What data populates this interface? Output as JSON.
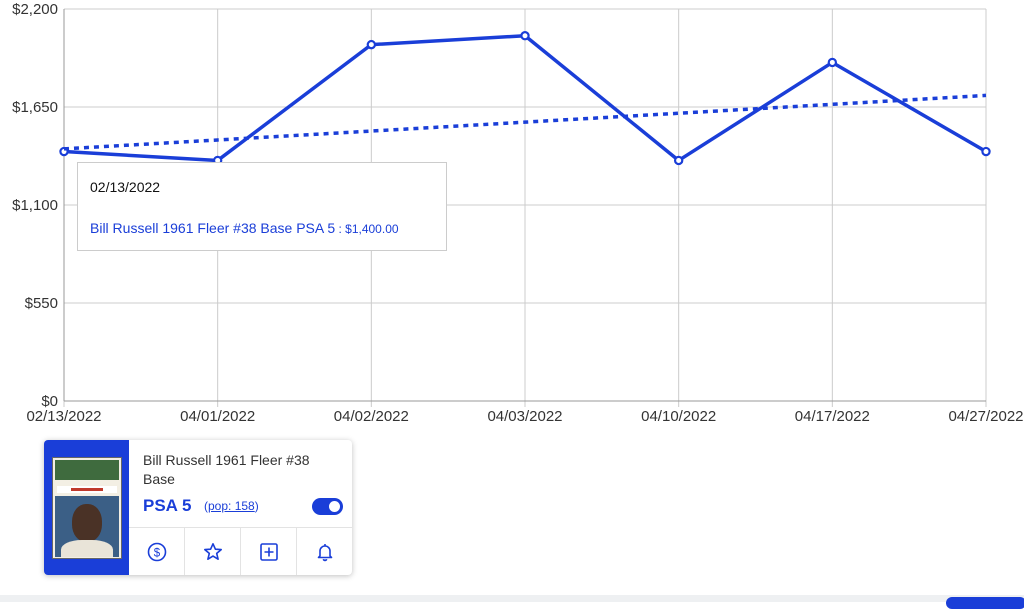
{
  "chart_data": {
    "type": "line",
    "categories": [
      "02/13/2022",
      "04/01/2022",
      "04/02/2022",
      "04/03/2022",
      "04/10/2022",
      "04/17/2022",
      "04/27/2022"
    ],
    "series": [
      {
        "values": [
          1400,
          1350,
          2000,
          2050,
          1350,
          1900,
          1400
        ],
        "style": "solid",
        "color": "#1a3ed8"
      },
      {
        "values": [
          1415,
          1465,
          1515,
          1565,
          1615,
          1665,
          1715
        ],
        "style": "dotted",
        "color": "#1a3ed8"
      }
    ],
    "y_ticks": [
      {
        "value": 0,
        "label": "$0"
      },
      {
        "value": 550,
        "label": "$550"
      },
      {
        "value": 1100,
        "label": "$1,100"
      },
      {
        "value": 1650,
        "label": "$1,650"
      },
      {
        "value": 2200,
        "label": "$2,200"
      }
    ],
    "ylim": [
      0,
      2200
    ],
    "grid": true,
    "title": "",
    "xlabel": "",
    "ylabel": ""
  },
  "tooltip": {
    "date": "02/13/2022",
    "series_label": "Bill Russell 1961 Fleer #38 Base PSA 5",
    "separator": " : ",
    "value": "$1,400.00"
  },
  "card": {
    "title": "Bill Russell 1961 Fleer #38 Base",
    "grade": "PSA 5",
    "pop_open": "(",
    "pop_label": "pop: 158",
    "pop_close": ")",
    "toggle_on": true,
    "actions": [
      "dollar-circle-icon",
      "star-icon",
      "plus-square-icon",
      "bell-icon"
    ]
  },
  "colors": {
    "accent": "#1a3ed8",
    "grid": "#cccccc"
  }
}
